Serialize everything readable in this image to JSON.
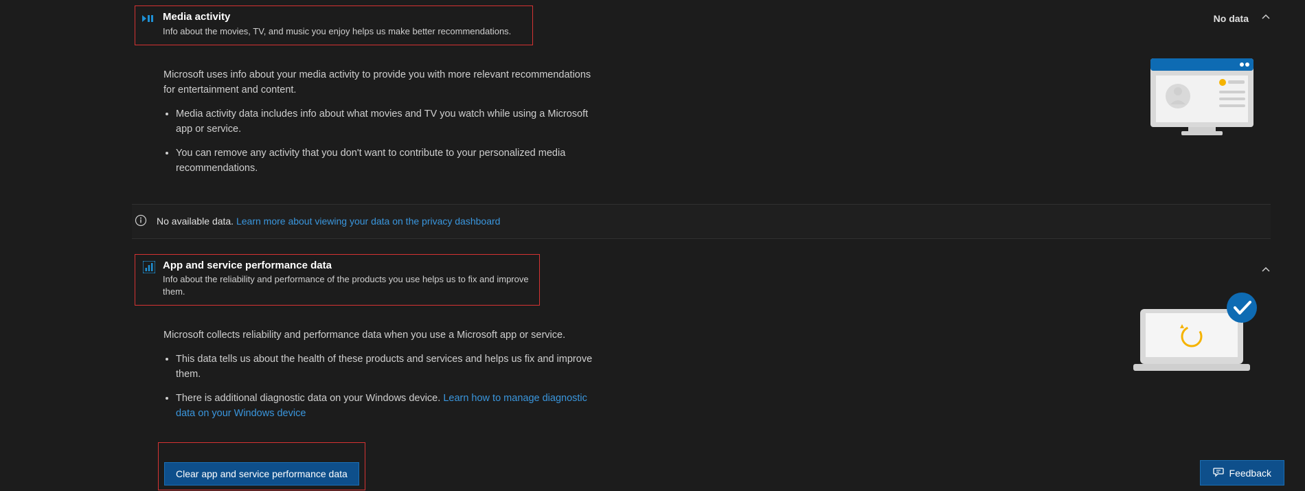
{
  "sections": [
    {
      "icon": "media-play-icon",
      "title": "Media activity",
      "subtitle": "Info about the movies, TV, and music you enjoy helps us make better recommendations.",
      "status": "No data",
      "intro": "Microsoft uses info about your media activity to provide you with more relevant recommendations for entertainment and content.",
      "bullets": [
        "Media activity data includes info about what movies and TV you watch while using a Microsoft app or service.",
        "You can remove any activity that you don't want to contribute to your personalized media recommendations."
      ]
    },
    {
      "icon": "chart-icon",
      "title": "App and service performance data",
      "subtitle": "Info about the reliability and performance of the products you use helps us to fix and improve them.",
      "intro": "Microsoft collects reliability and performance data when you use a Microsoft app or service.",
      "bullets": [
        "This data tells us about the health of these products and services and helps us fix and improve them.",
        "There is additional diagnostic data on your Windows device."
      ],
      "diag_link": "Learn how to manage diagnostic data on your Windows device",
      "clear_btn": "Clear app and service performance data"
    }
  ],
  "info_bar": {
    "text": "No available data.",
    "link": "Learn more about viewing your data on the privacy dashboard"
  },
  "feedback_label": "Feedback"
}
